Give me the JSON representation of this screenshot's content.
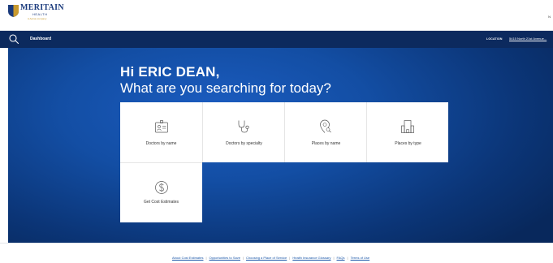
{
  "brand": {
    "name": "MERITAIN",
    "sub": "HEALTH",
    "tagline": "A Aetna company",
    "colors": {
      "navy": "#0c2a5e",
      "hero": "#134ea4",
      "gold": "#c99a2e"
    }
  },
  "header": {
    "user_initials": "N"
  },
  "nav": {
    "search_icon": "search-icon",
    "dashboard_label": "Dashboard",
    "location_label": "LOCATION",
    "location_value": "5415 North 21st Avenue..."
  },
  "main": {
    "greeting": "Hi ERIC DEAN,",
    "subtitle": "What are you searching for today?",
    "tiles": [
      {
        "label": "Doctors by name",
        "icon": "id-badge-icon"
      },
      {
        "label": "Doctors by specialty",
        "icon": "stethoscope-icon"
      },
      {
        "label": "Places by name",
        "icon": "location-search-icon"
      },
      {
        "label": "Places by type",
        "icon": "building-icon"
      },
      {
        "label": "Get Cost Estimates",
        "icon": "dollar-circle-icon"
      }
    ]
  },
  "footer": {
    "links": [
      "About Cost Estimates",
      "Opportunities to Save",
      "Choosing a Place of Service",
      "Health Insurance Glossary",
      "FAQs",
      "Terms of Use"
    ]
  }
}
